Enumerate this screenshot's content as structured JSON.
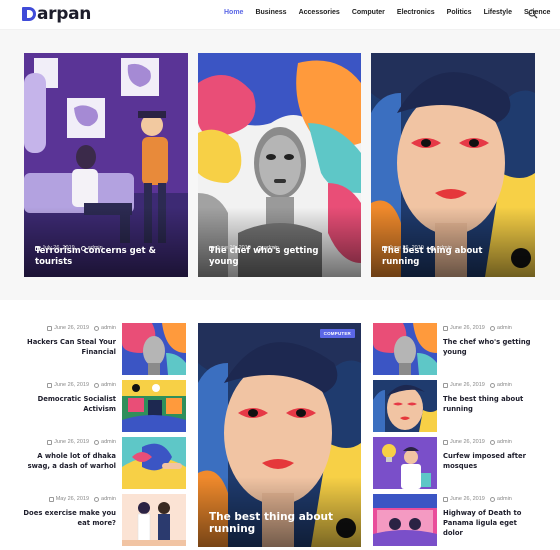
{
  "brand": {
    "logo_text": "arpan",
    "logo_letter": "D",
    "accent": "#5b67e6"
  },
  "nav": {
    "items": [
      {
        "label": "Home",
        "active": true
      },
      {
        "label": "Business"
      },
      {
        "label": "Accessories"
      },
      {
        "label": "Computer"
      },
      {
        "label": "Electronics"
      },
      {
        "label": "Politics"
      },
      {
        "label": "Lifestyle"
      },
      {
        "label": "Science"
      }
    ],
    "search_icon": "search-icon"
  },
  "hero": [
    {
      "date": "July 26, 2019",
      "author": "admin",
      "title": "Terrorism concerns get & tourists"
    },
    {
      "date": "June 26, 2019",
      "author": "admin",
      "title": "The chef who's getting young"
    },
    {
      "date": "June 26, 2019",
      "author": "admin",
      "title": "The best thing about running"
    }
  ],
  "left_list": [
    {
      "date": "June 26, 2019",
      "author": "admin",
      "title": "Hackers Can Steal Your Financial"
    },
    {
      "date": "June 26, 2019",
      "author": "admin",
      "title": "Democratic Socialist Activism"
    },
    {
      "date": "June 26, 2019",
      "author": "admin",
      "title": "A whole lot of dhaka swag, a dash of warhol"
    },
    {
      "date": "May 26, 2019",
      "author": "admin",
      "title": "Does exercise make you eat more?"
    }
  ],
  "featured": {
    "badge": "COMPUTER",
    "title": "The best thing about running"
  },
  "right_list": [
    {
      "date": "June 26, 2019",
      "author": "admin",
      "title": "The chef who's getting young"
    },
    {
      "date": "June 26, 2019",
      "author": "admin",
      "title": "The best thing about running"
    },
    {
      "date": "June 26, 2019",
      "author": "admin",
      "title": "Curfew imposed after mosques"
    },
    {
      "date": "June 26, 2019",
      "author": "admin",
      "title": "Highway of Death to Panama ligula eget dolor"
    }
  ]
}
